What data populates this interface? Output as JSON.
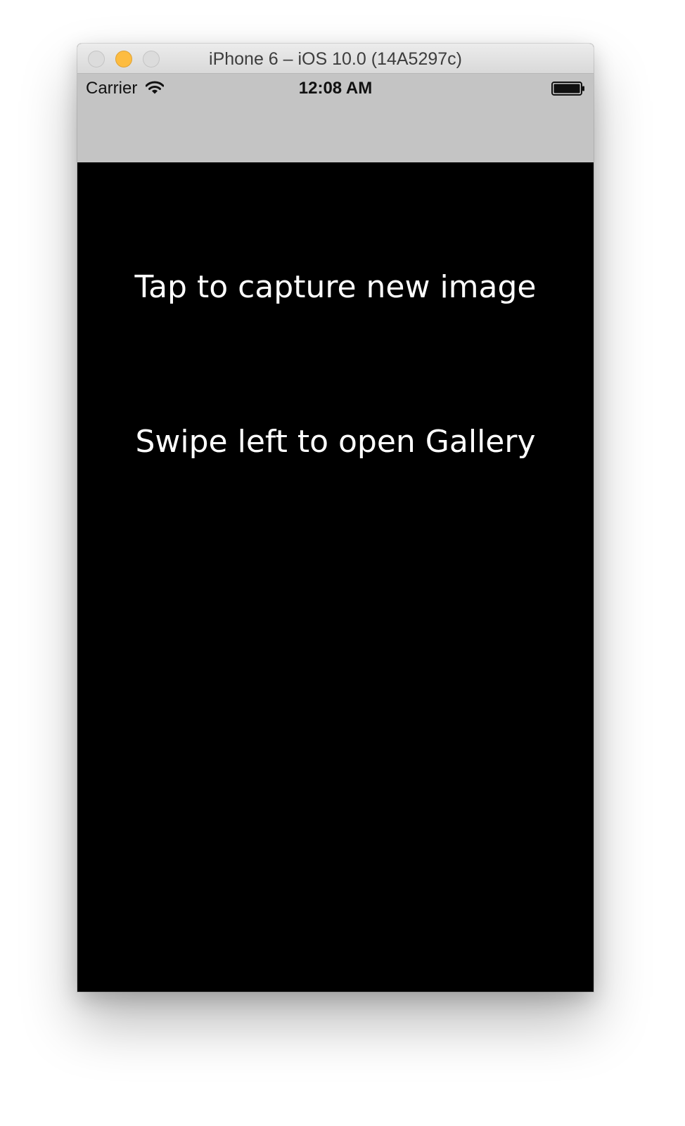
{
  "window": {
    "title": "iPhone 6 – iOS 10.0 (14A5297c)"
  },
  "statusbar": {
    "carrier": "Carrier",
    "time": "12:08 AM",
    "wifi_icon": "wifi-icon",
    "battery_icon": "battery-icon"
  },
  "main": {
    "tap_hint": "Tap to capture new image",
    "swipe_hint": "Swipe left to open Gallery"
  },
  "colors": {
    "statusbar_bg": "#c4c4c4",
    "content_bg": "#000000",
    "text": "#ffffff",
    "minimize_button": "#fdbc40"
  }
}
